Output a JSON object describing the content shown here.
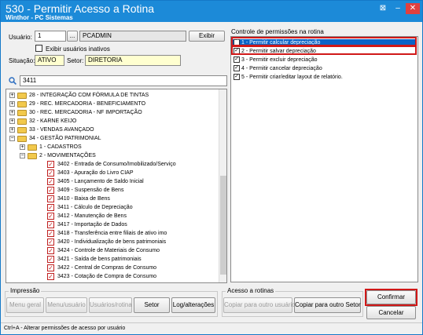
{
  "window": {
    "title": "530 - Permitir Acesso a Rotina",
    "subtitle": "Winthor - PC Sistemas",
    "controls": [
      "⊠",
      "–",
      "✕"
    ]
  },
  "user": {
    "label": "Usuário:",
    "code": "1",
    "browse": "...",
    "name": "PCADMIN",
    "show_button": "Exibir",
    "show_inactive_label": "Exibir usuários inativos",
    "situation_label": "Situação:",
    "situation": "ATIVO",
    "sector_label": "Setor:",
    "sector": "DIRETORIA"
  },
  "search": {
    "value": "3411"
  },
  "permissions": {
    "title": "Controle de permissões na rotina",
    "items": [
      {
        "label": "1 - Permitir calcular depreciação",
        "checked": "✓"
      },
      {
        "label": "2 - Permitir salvar depreciação",
        "checked": "✓"
      },
      {
        "label": "3 - Permitir excluir depreciação",
        "checked": "✓"
      },
      {
        "label": "4 - Permitir cancelar depreciação",
        "checked": "✓"
      },
      {
        "label": "5 - Permitir criar/editar layout de relatório.",
        "checked": "✓"
      }
    ]
  },
  "tree": {
    "rows": [
      {
        "expander": "+",
        "label": "28 - INTEGRAÇÃO COM FÓRMULA DE TINTAS"
      },
      {
        "expander": "+",
        "label": "29 - REC. MERCADORIA - BENEFICIAMENTO"
      },
      {
        "expander": "+",
        "label": "30 - REC. MERCADORIA - NF IMPORTAÇÃO"
      },
      {
        "expander": "+",
        "label": "32 - KARNE KEIJO"
      },
      {
        "expander": "+",
        "label": "33 - VENDAS AVANÇADO"
      },
      {
        "expander": "−",
        "label": "34 - GESTÃO PATRIMONIAL"
      },
      {
        "expander": "+",
        "label": "1 - CADASTROS"
      },
      {
        "expander": "−",
        "label": "2 - MOVIMENTAÇÕES"
      },
      {
        "check": "✓",
        "label": "3402 - Entrada de Consumo/Imobilizado/Serviço"
      },
      {
        "check": "✓",
        "label": "3403 - Apuração do Livro CIAP"
      },
      {
        "check": "✓",
        "label": "3405 - Lançamento de Saldo Inicial"
      },
      {
        "check": "✓",
        "label": "3409 - Suspensão de Bens"
      },
      {
        "check": "✓",
        "label": "3410 - Baixa de Bens"
      },
      {
        "check": "✓",
        "label": "3411 - Cálculo de Depreciação"
      },
      {
        "check": "✓",
        "label": "3412 - Manutenção de Bens"
      },
      {
        "check": "✓",
        "label": "3417 - Importação de Dados"
      },
      {
        "check": "✓",
        "label": "3418 - Transferência entre filiais de ativo imo"
      },
      {
        "check": "✓",
        "label": "3420 - Individualização de bens patrimoniais"
      },
      {
        "check": "✓",
        "label": "3424 - Controle de Materiais de Consumo"
      },
      {
        "check": "✓",
        "label": "3421 - Saída de bens patrimoniais"
      },
      {
        "check": "✓",
        "label": "3422 - Central de Compras de Consumo"
      },
      {
        "check": "✓",
        "label": "3423 - Cotação de Compra de Consumo"
      },
      {
        "expander": "+",
        "label": "3 - PROCESSAMENTO"
      }
    ]
  },
  "impressao": {
    "title": "Impressão",
    "buttons": [
      "Menu geral",
      "Menu/usuário",
      "Usuários/rotina",
      "Setor",
      "Log/alterações"
    ]
  },
  "acesso": {
    "title": "Acesso a rotinas",
    "buttons": [
      "Copiar para outro usuário",
      "Copiar para outro Setor"
    ]
  },
  "actions": {
    "confirm": "Confirmar",
    "cancel": "Cancelar"
  },
  "status": "Ctrl+A - Alterar permissões de acesso por usuário",
  "colors": {
    "titlebar": "#1c8ad8",
    "selection": "#0a64c8",
    "highlight": "#d01818"
  }
}
